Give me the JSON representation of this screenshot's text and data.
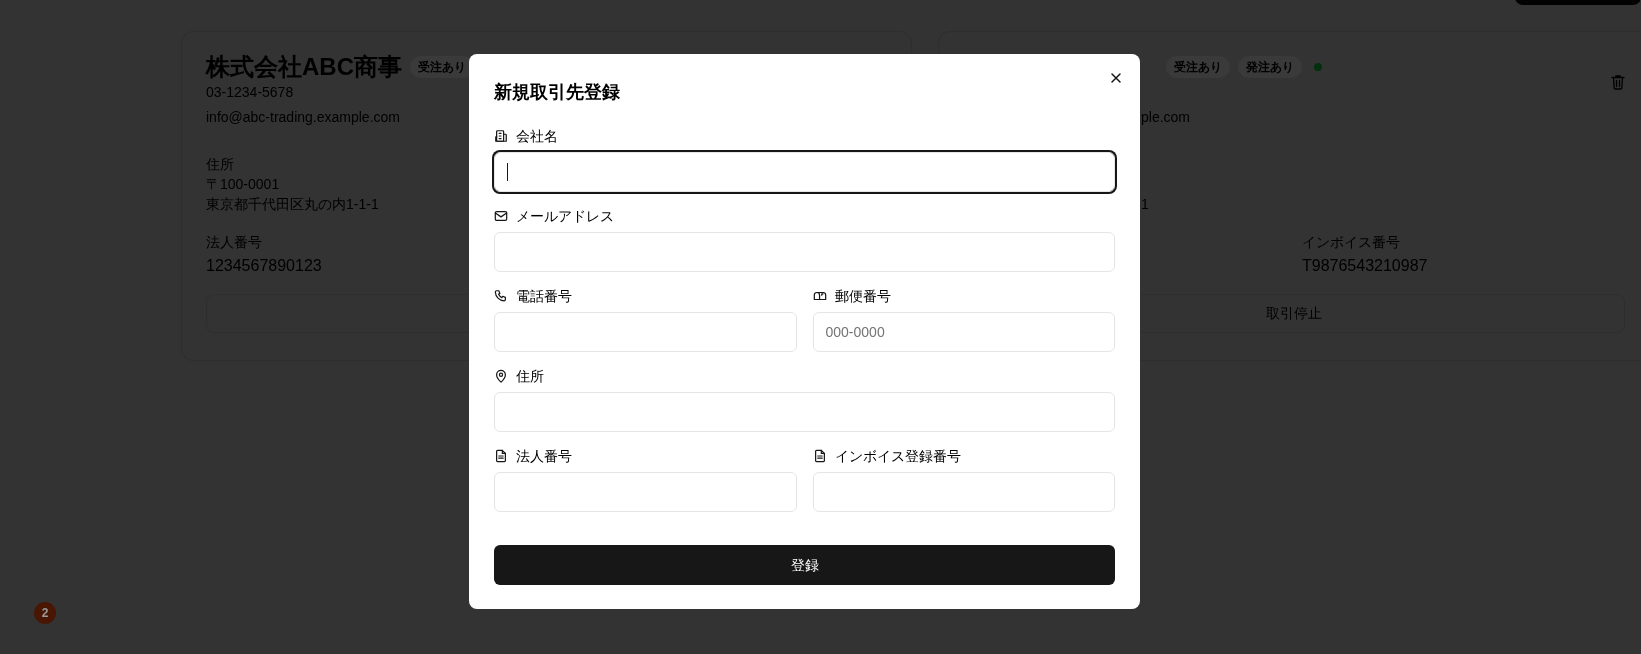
{
  "page": {
    "cards": [
      {
        "title": "株式会社ABC商事",
        "badges": [
          {
            "label": "受注あり"
          }
        ],
        "phone": "03-1234-5678",
        "email": "info@abc-trading.example.com",
        "address": {
          "label": "住所",
          "lines": [
            "〒100-0001",
            "東京都千代田区丸の内1-1-1"
          ]
        },
        "ids": [
          {
            "kind": "corporate",
            "label": "法人番号",
            "value": "1234567890123"
          }
        ]
      },
      {
        "badges": [
          {
            "label": "受注あり"
          },
          {
            "label": "発注あり"
          }
        ],
        "active": true,
        "has_delete": true,
        "email": "ple.com",
        "address": {
          "lines": [
            "1"
          ]
        },
        "ids": [
          {
            "kind": "invoice",
            "label": "インボイス番号",
            "value": "T9876543210987"
          }
        ],
        "action": "取引停止"
      }
    ],
    "notification_count": "2"
  },
  "modal": {
    "title": "新規取引先登録",
    "rows": [
      [
        {
          "kind": "company",
          "label": "会社名",
          "focused": true
        }
      ],
      [
        {
          "kind": "email",
          "label": "メールアドレス",
          "focused": false
        }
      ],
      [
        {
          "kind": "phone",
          "label": "電話番号",
          "focused": false
        },
        {
          "kind": "postal",
          "label": "郵便番号",
          "placeholder": "000-0000",
          "focused": false
        }
      ],
      [
        {
          "kind": "address",
          "label": "住所",
          "focused": false
        }
      ],
      [
        {
          "kind": "corporate",
          "label": "法人番号",
          "focused": false
        },
        {
          "kind": "invoice",
          "label": "インボイス登録番号",
          "focused": false
        }
      ]
    ],
    "submit": "登録"
  }
}
